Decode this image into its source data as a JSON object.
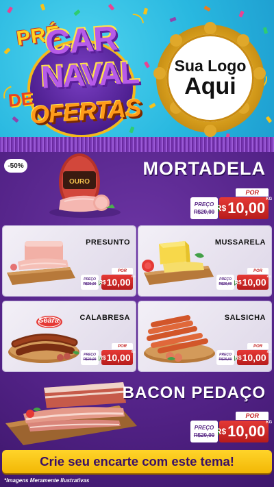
{
  "header": {
    "title_pre": "PRÉ",
    "title_car": "CAR",
    "title_naval": "NAVAL",
    "title_de": "DE",
    "title_ofertas": "OFERTAS",
    "logo_line1": "Sua Logo",
    "logo_line2": "Aqui"
  },
  "featured_top": {
    "badge": "-50%",
    "name": "MORTADELA",
    "brand": "OURO",
    "price": {
      "por": "POR",
      "preco_label": "PREÇO",
      "old": "R$20,00",
      "currency": "R$",
      "value": "10,00",
      "unit": "KG"
    }
  },
  "grid": [
    {
      "name": "PRESUNTO",
      "price": {
        "por": "POR",
        "preco_label": "PREÇO",
        "old": "R$20,00",
        "currency": "R$",
        "value": "10,00",
        "unit": "KG"
      }
    },
    {
      "name": "MUSSARELA",
      "price": {
        "por": "POR",
        "preco_label": "PREÇO",
        "old": "R$20,00",
        "currency": "R$",
        "value": "10,00",
        "unit": "KG"
      }
    },
    {
      "name": "CALABRESA",
      "brand": "Seara",
      "price": {
        "por": "POR",
        "preco_label": "PREÇO",
        "old": "R$20,00",
        "currency": "R$",
        "value": "10,00",
        "unit": "KG"
      }
    },
    {
      "name": "SALSICHA",
      "price": {
        "por": "POR",
        "preco_label": "PREÇO",
        "old": "R$20,00",
        "currency": "R$",
        "value": "10,00",
        "unit": "KG"
      }
    }
  ],
  "featured_bottom": {
    "name": "BACON PEDAÇO",
    "price": {
      "por": "POR",
      "preco_label": "PREÇO",
      "old": "R$20,00",
      "currency": "R$",
      "value": "10,00",
      "unit": "KG"
    }
  },
  "footer": {
    "cta": "Crie seu encarte com este tema!",
    "disclaimer": "*Imagens Meramente Ilustrativas"
  },
  "colors": {
    "header_bg": "#29b8e0",
    "main_bg": "#522286",
    "price_red": "#d32f2f",
    "cta_yellow": "#f7c21a"
  }
}
